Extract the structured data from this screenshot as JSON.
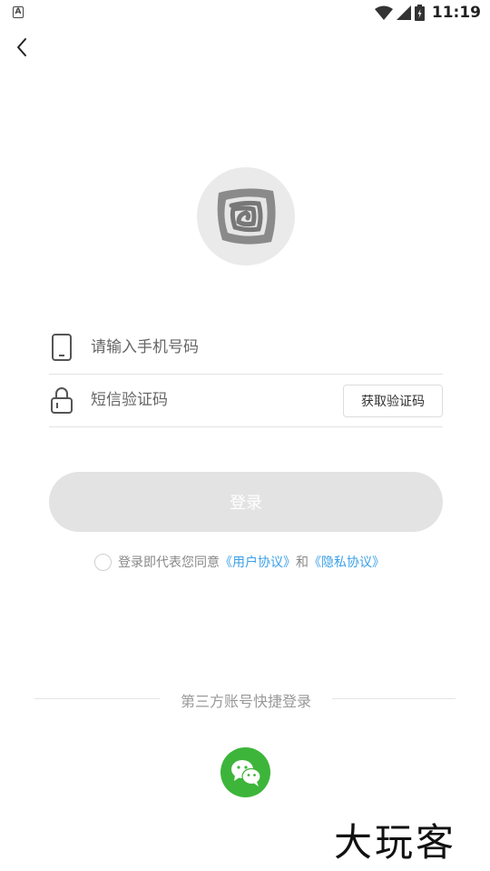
{
  "status_bar": {
    "notification": "A",
    "time": "11:19"
  },
  "login_form": {
    "phone_placeholder": "请输入手机号码",
    "code_placeholder": "短信验证码",
    "get_code_label": "获取验证码",
    "login_label": "登录"
  },
  "agreement": {
    "prefix": "登录即代表您同意",
    "user_agreement": "《用户协议》",
    "and": "和",
    "privacy_policy": "《隐私协议》"
  },
  "third_party": {
    "title": "第三方账号快捷登录"
  },
  "watermark": "大玩客",
  "colors": {
    "link": "#3aa0e8",
    "wechat": "#3db53a",
    "login_disabled": "#e3e3e3"
  },
  "icons": [
    "back-arrow-icon",
    "phone-icon",
    "lock-icon",
    "wechat-icon",
    "wifi-icon",
    "signal-icon",
    "battery-icon"
  ]
}
